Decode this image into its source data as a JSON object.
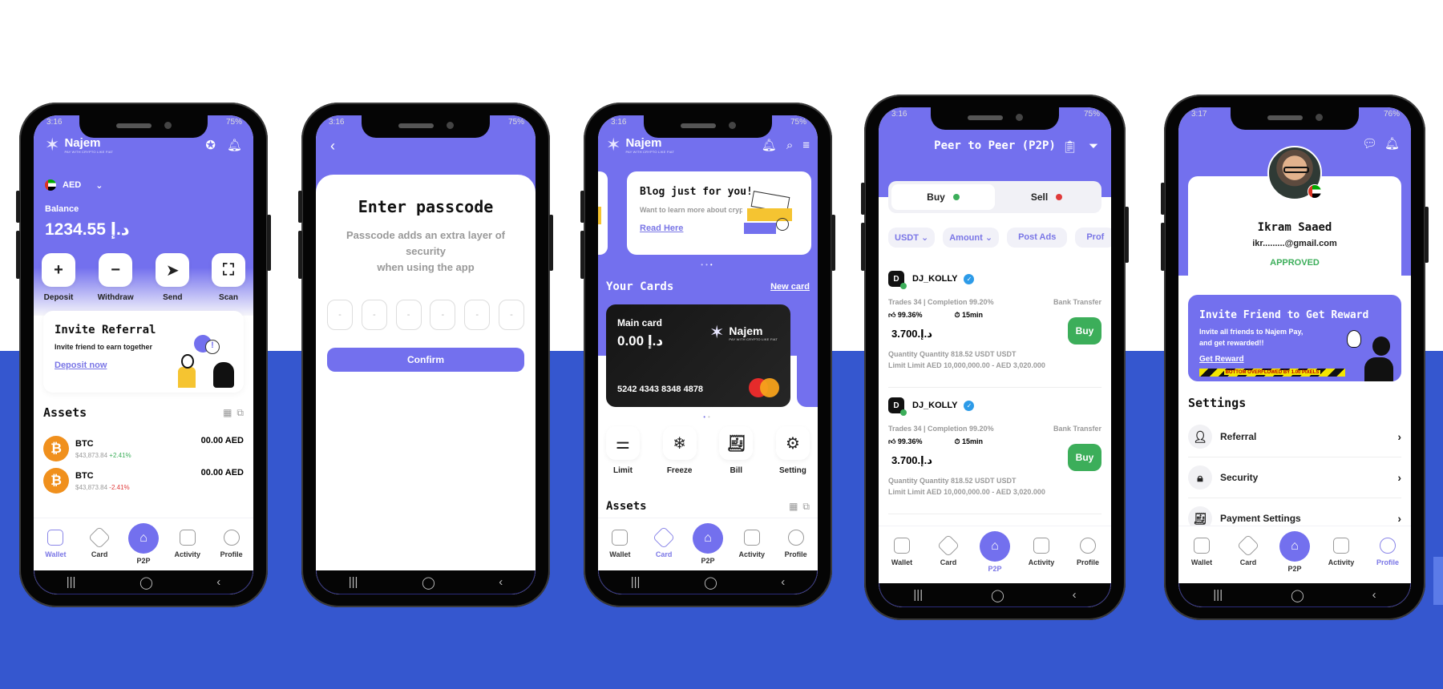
{
  "common": {
    "brand": "Najem",
    "tagline": "PAY WITH CRYPTO LIKE FIAT",
    "status_time": "3:16",
    "status_battery": "75%",
    "status_time_profile": "3:17",
    "status_battery_profile": "76%",
    "tabs": [
      "Wallet",
      "Card",
      "P2P",
      "Activity",
      "Profile"
    ],
    "sysnav": {
      "recents": "|||",
      "home": "◯",
      "back": "‹"
    },
    "colors": {
      "primary": "#7370ee",
      "band": "#3557cf",
      "green": "#3cae5a",
      "red": "#e03a3a"
    }
  },
  "wallet": {
    "currency": "AED",
    "balance_label": "Balance",
    "balance": "1234.55 د.إ",
    "actions": [
      "Deposit",
      "Withdraw",
      "Send",
      "Scan"
    ],
    "invite": {
      "title": "Invite Referral",
      "subtitle": "Invite friend to earn together",
      "link": "Deposit now"
    },
    "assets_title": "Assets",
    "assets": [
      {
        "symbol": "BTC",
        "price": "$43,873.84",
        "change": "+2.41%",
        "amount": "00.00 AED"
      },
      {
        "symbol": "BTC",
        "price": "$43,873.84",
        "change": "-2.41%",
        "amount": "00.00 AED"
      }
    ],
    "active_tab": "Wallet"
  },
  "passcode": {
    "title": "Enter passcode",
    "subtitle_1": "Passcode adds an extra layer of security",
    "subtitle_2": "when using the app",
    "digits": [
      "-",
      "-",
      "-",
      "-",
      "-",
      "-"
    ],
    "confirm": "Confirm"
  },
  "card": {
    "blog": {
      "title": "Blog just for you!",
      "subtitle": "Want to learn more about crypto?",
      "link": "Read Here"
    },
    "your_cards": "Your Cards",
    "new_card": "New card",
    "main_card": {
      "label": "Main card",
      "balance": "0.00 د.إ",
      "number": "5242 4343 8348 4878"
    },
    "actions": [
      "Limit",
      "Freeze",
      "Bill",
      "Setting"
    ],
    "assets_title": "Assets",
    "active_tab": "Card"
  },
  "p2p": {
    "title": "Peer to Peer (P2P)",
    "buy": "Buy",
    "sell": "Sell",
    "filters": [
      "USDT",
      "Amount",
      "Post Ads",
      "Prof"
    ],
    "offers": [
      {
        "user": "DJ_KOLLY",
        "avatar": "D",
        "stats": "Trades 34 | Completion 99.20%",
        "method": "Bank Transfer",
        "rating": "99.36%",
        "time": "15min",
        "price": "3.700.د.إ",
        "quantity": "Quantity Quantity 818.52 USDT USDT",
        "limit": "Limit Limit AED 10,000,000.00 - AED 3,020.000",
        "action": "Buy"
      },
      {
        "user": "DJ_KOLLY",
        "avatar": "D",
        "stats": "Trades 34 | Completion 99.20%",
        "method": "Bank Transfer",
        "rating": "99.36%",
        "time": "15min",
        "price": "3.700.د.إ",
        "quantity": "Quantity Quantity 818.52 USDT USDT",
        "limit": "Limit Limit AED 10,000,000.00 - AED 3,020.000",
        "action": "Buy"
      }
    ],
    "active_tab": "P2P"
  },
  "profile": {
    "name": "Ikram Saaed",
    "email": "ikr.........@gmail.com",
    "status": "APPROVED",
    "reward": {
      "title": "Invite Friend to Get Reward",
      "subtitle_1": "Invite all friends to Najem Pay,",
      "subtitle_2": "and get rewarded!!",
      "link": "Get Reward",
      "overflow_warning": "BOTTOM OVERFLOWED BY 1.00 PIXELS"
    },
    "settings_title": "Settings",
    "settings": [
      "Referral",
      "Security",
      "Payment Settings"
    ],
    "active_tab": "Profile"
  }
}
